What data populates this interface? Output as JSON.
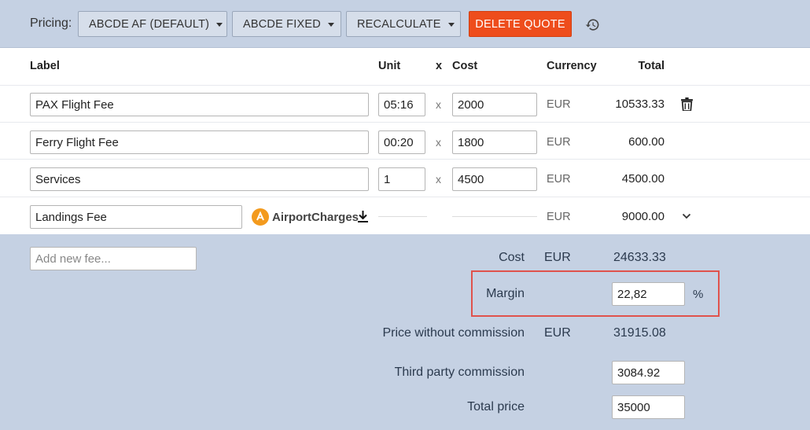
{
  "toolbar": {
    "pricing_label": "Pricing:",
    "price_list": "ABCDE AF (DEFAULT)",
    "fixed_option": "ABCDE FIXED",
    "recalculate": "RECALCULATE",
    "delete_quote": "DELETE QUOTE"
  },
  "columns": {
    "label": "Label",
    "unit": "Unit",
    "x": "x",
    "cost": "Cost",
    "currency": "Currency",
    "total": "Total"
  },
  "rows": [
    {
      "label": "PAX Flight Fee",
      "unit": "05:16",
      "x": "x",
      "cost": "2000",
      "currency": "EUR",
      "total": "10533.33"
    },
    {
      "label": "Ferry Flight Fee",
      "unit": "00:20",
      "x": "x",
      "cost": "1800",
      "currency": "EUR",
      "total": "600.00"
    },
    {
      "label": "Services",
      "unit": "1",
      "x": "x",
      "cost": "4500",
      "currency": "EUR",
      "total": "4500.00"
    },
    {
      "label": "Landings Fee",
      "provider": "AirportCharges",
      "currency": "EUR",
      "total": "9000.00"
    }
  ],
  "summary": {
    "add_fee_placeholder": "Add new fee...",
    "cost_label": "Cost",
    "cost_currency": "EUR",
    "cost_value": "24633.33",
    "margin_label": "Margin",
    "margin_value": "22,82",
    "margin_unit": "%",
    "price_wo_commission_label": "Price without commission",
    "price_wo_commission_currency": "EUR",
    "price_wo_commission_value": "31915.08",
    "third_party_label": "Third party commission",
    "third_party_value": "3084.92",
    "total_price_label": "Total price",
    "total_price_value": "35000"
  },
  "colors": {
    "toolbar_bg": "#c5d1e3",
    "delete_button": "#ee4d1c",
    "highlight_border": "#e0524c",
    "airportcharges_logo": "#f39a1d"
  },
  "icons": [
    "history-icon",
    "trash-icon",
    "chevron-down-icon",
    "download-icon",
    "airportcharges-logo"
  ]
}
